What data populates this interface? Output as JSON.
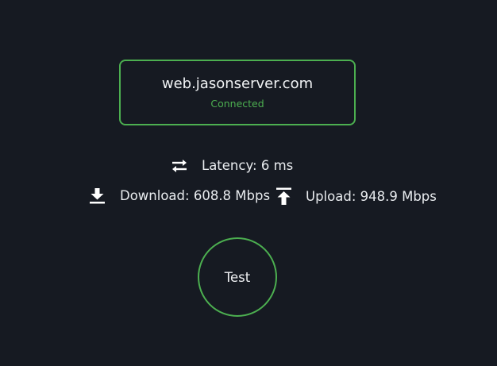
{
  "server": {
    "host": "web.jasonserver.com",
    "status": "Connected"
  },
  "metrics": {
    "latency": {
      "icon": "swap-arrows-icon",
      "label": "Latency: 6 ms"
    },
    "download": {
      "icon": "download-icon",
      "label": "Download: 608.8 Mbps"
    },
    "upload": {
      "icon": "upload-icon",
      "label": "Upload: 948.9 Mbps"
    }
  },
  "actions": {
    "test_label": "Test"
  },
  "colors": {
    "background": "#161a22",
    "accent": "#4caf50",
    "text": "#e9ecef"
  }
}
